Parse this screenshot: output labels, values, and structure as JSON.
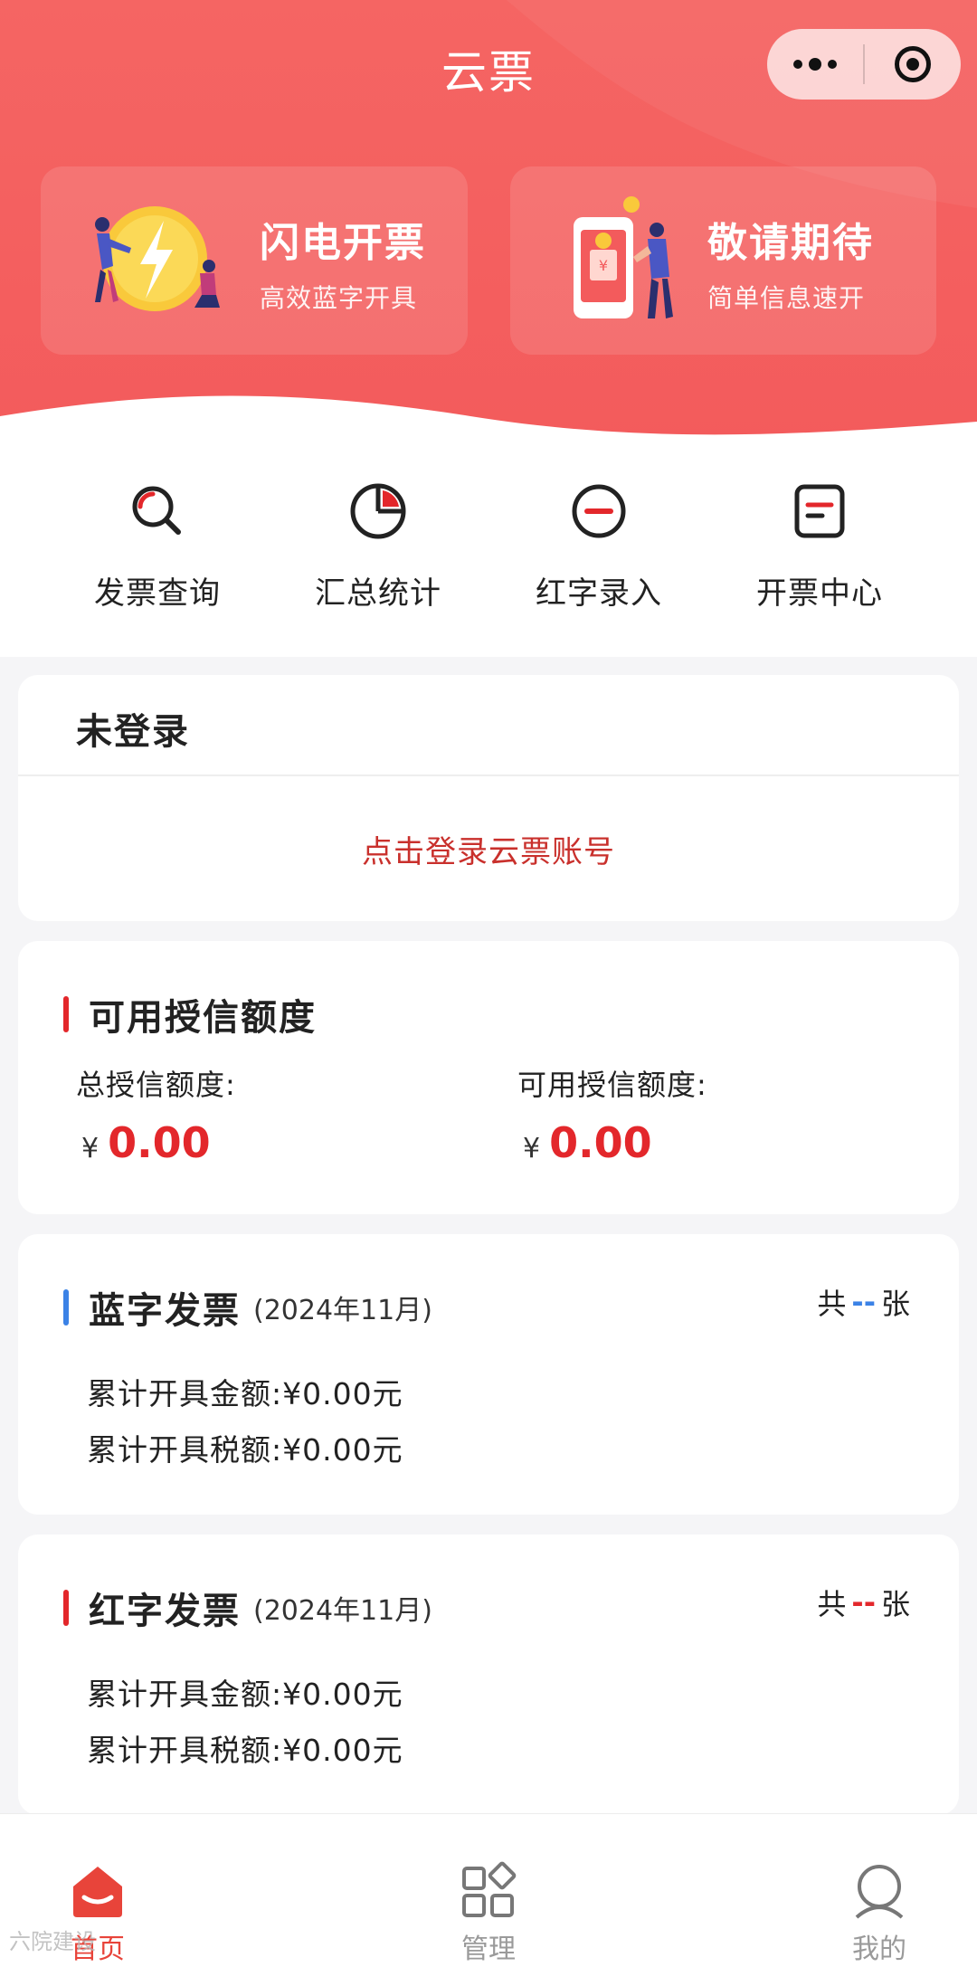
{
  "nav": {
    "title": "云票"
  },
  "promos": [
    {
      "title": "闪电开票",
      "subtitle": "高效蓝字开具"
    },
    {
      "title": "敬请期待",
      "subtitle": "简单信息速开"
    }
  ],
  "quick_actions": [
    {
      "label": "发票查询",
      "icon": "search-icon"
    },
    {
      "label": "汇总统计",
      "icon": "pie-chart-icon"
    },
    {
      "label": "红字录入",
      "icon": "minus-circle-icon"
    },
    {
      "label": "开票中心",
      "icon": "invoice-icon"
    }
  ],
  "login": {
    "status": "未登录",
    "link": "点击登录云票账号"
  },
  "credit": {
    "title": "可用授信额度",
    "total_label": "总授信额度:",
    "total_value": "0.00",
    "available_label": "可用授信额度:",
    "available_value": "0.00",
    "currency": "¥"
  },
  "blue_invoice": {
    "title": "蓝字发票",
    "period": "(2024年11月)",
    "count_prefix": "共",
    "count": "--",
    "count_suffix": "张",
    "amount_line": "累计开具金额:¥0.00元",
    "tax_line": "累计开具税额:¥0.00元",
    "accent": "#3b82e6"
  },
  "red_invoice": {
    "title": "红字发票",
    "period": "(2024年11月)",
    "count_prefix": "共",
    "count": "--",
    "count_suffix": "张",
    "amount_line": "累计开具金额:¥0.00元",
    "tax_line": "累计开具税额:¥0.00元",
    "accent": "#e3272b"
  },
  "tabbar": {
    "items": [
      {
        "label": "首页",
        "icon": "home-icon",
        "active": true
      },
      {
        "label": "管理",
        "icon": "apps-icon",
        "active": false
      },
      {
        "label": "我的",
        "icon": "user-icon",
        "active": false
      }
    ],
    "active_color": "#e8443a",
    "inactive_color": "#9a9a9a"
  },
  "watermark": "六院建设"
}
